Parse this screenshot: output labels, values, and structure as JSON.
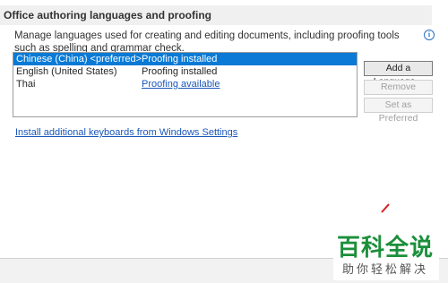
{
  "section": {
    "title": "Office authoring languages and proofing",
    "description": "Manage languages used for creating and editing documents, including proofing tools such as spelling and grammar check.",
    "info_icon": "i"
  },
  "languages": [
    {
      "name": "Chinese (China) <preferred>",
      "status": "Proofing installed",
      "selected": true,
      "status_is_link": false
    },
    {
      "name": "English (United States)",
      "status": "Proofing installed",
      "selected": false,
      "status_is_link": false
    },
    {
      "name": "Thai",
      "status": "Proofing available",
      "selected": false,
      "status_is_link": true
    }
  ],
  "buttons": {
    "add_language": "Add a Language...",
    "remove": "Remove",
    "set_preferred": "Set as Preferred"
  },
  "install_link": "Install additional keyboards from Windows Settings",
  "watermark": {
    "title": "百科全说",
    "subtitle": "助你轻松解决"
  },
  "colors": {
    "selection": "#0a7ad6",
    "link": "#1a56b8",
    "watermark_green": "#1b8f3a"
  }
}
